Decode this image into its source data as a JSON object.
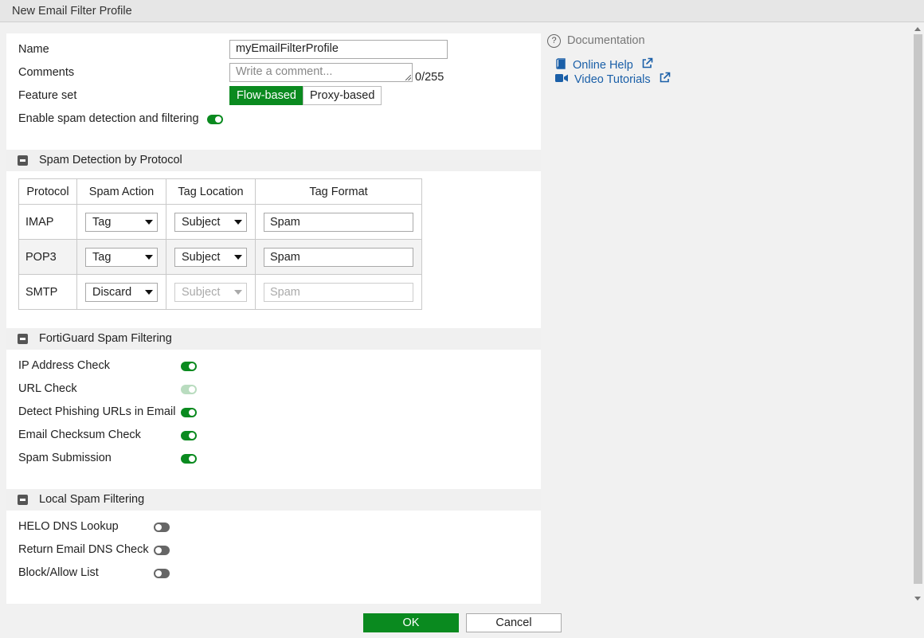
{
  "window": {
    "title": "New Email Filter Profile"
  },
  "form": {
    "name_label": "Name",
    "name_value": "myEmailFilterProfile",
    "comments_label": "Comments",
    "comments_placeholder": "Write a comment...",
    "comments_count": "0/255",
    "feature_set_label": "Feature set",
    "feature_set_options": [
      "Flow-based",
      "Proxy-based"
    ],
    "feature_set_selected": "Flow-based",
    "spam_enable_label": "Enable spam detection and filtering",
    "spam_enable_on": true
  },
  "protocol_section": {
    "title": "Spam Detection by Protocol",
    "columns": [
      "Protocol",
      "Spam Action",
      "Tag Location",
      "Tag Format"
    ],
    "rows": [
      {
        "protocol": "IMAP",
        "action": "Tag",
        "location": "Subject",
        "format": "Spam",
        "location_disabled": false
      },
      {
        "protocol": "POP3",
        "action": "Tag",
        "location": "Subject",
        "format": "Spam",
        "location_disabled": false
      },
      {
        "protocol": "SMTP",
        "action": "Discard",
        "location": "Subject",
        "format": "Spam",
        "location_disabled": true
      }
    ]
  },
  "fortiguard_section": {
    "title": "FortiGuard Spam Filtering",
    "items": [
      {
        "label": "IP Address Check",
        "state": "on"
      },
      {
        "label": "URL Check",
        "state": "on-disabled"
      },
      {
        "label": "Detect Phishing URLs in Email",
        "state": "on"
      },
      {
        "label": "Email Checksum Check",
        "state": "on"
      },
      {
        "label": "Spam Submission",
        "state": "on"
      }
    ]
  },
  "local_section": {
    "title": "Local Spam Filtering",
    "items": [
      {
        "label": "HELO DNS Lookup",
        "state": "off"
      },
      {
        "label": "Return Email DNS Check",
        "state": "off"
      },
      {
        "label": "Block/Allow List",
        "state": "off"
      }
    ]
  },
  "documentation": {
    "title": "Documentation",
    "help_glyph": "?",
    "links": [
      {
        "label": "Online Help",
        "icon": "book-icon"
      },
      {
        "label": "Video Tutorials",
        "icon": "video-camera-icon"
      }
    ]
  },
  "footer": {
    "ok_label": "OK",
    "cancel_label": "Cancel"
  },
  "colors": {
    "accent": "#0a8a1f",
    "link": "#1a5fa8"
  }
}
